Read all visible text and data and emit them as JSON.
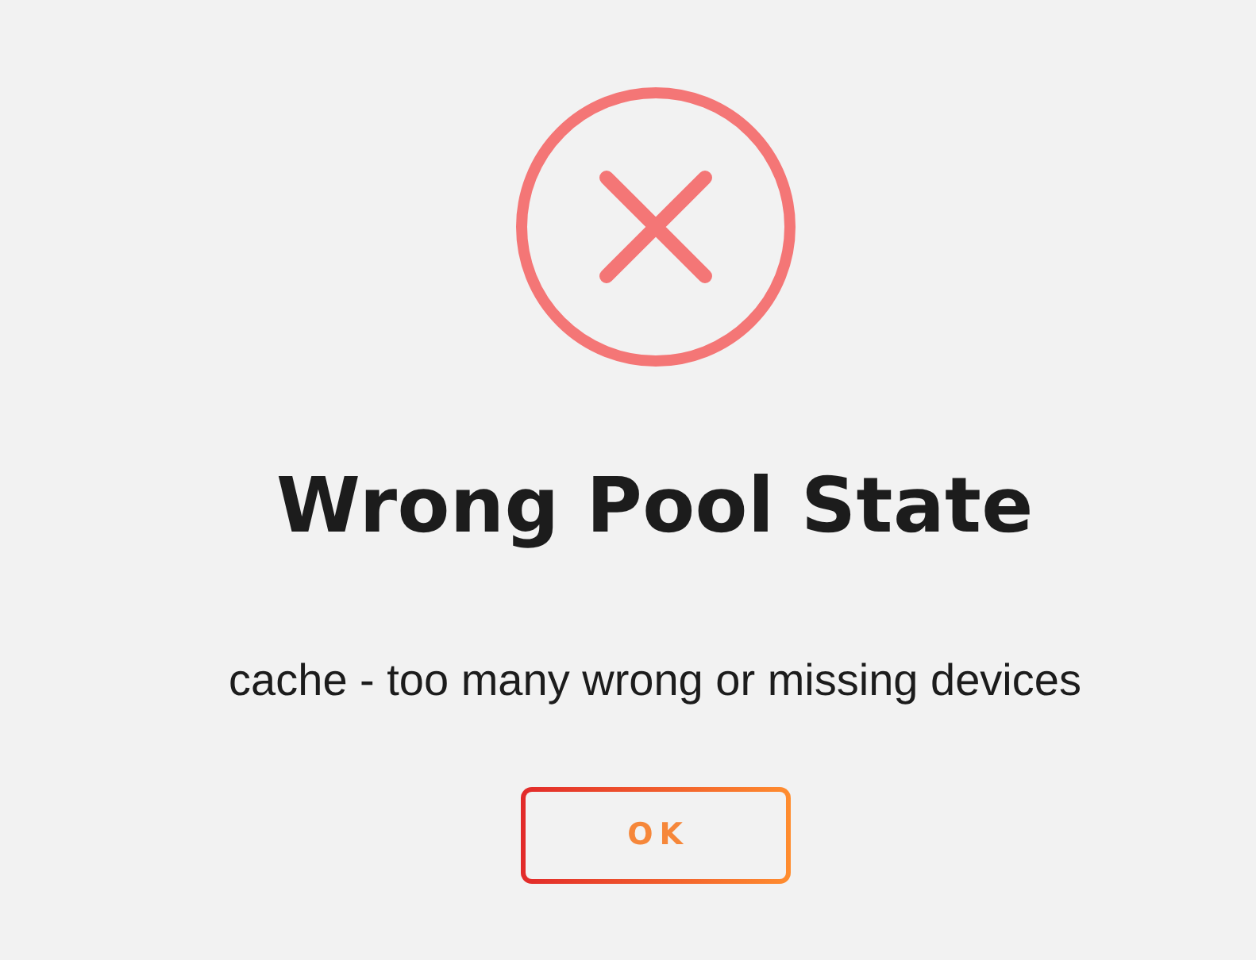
{
  "dialog": {
    "title": "Wrong Pool State",
    "message": "cache - too many wrong or missing devices",
    "buttons": [
      {
        "label": "OK"
      }
    ]
  }
}
